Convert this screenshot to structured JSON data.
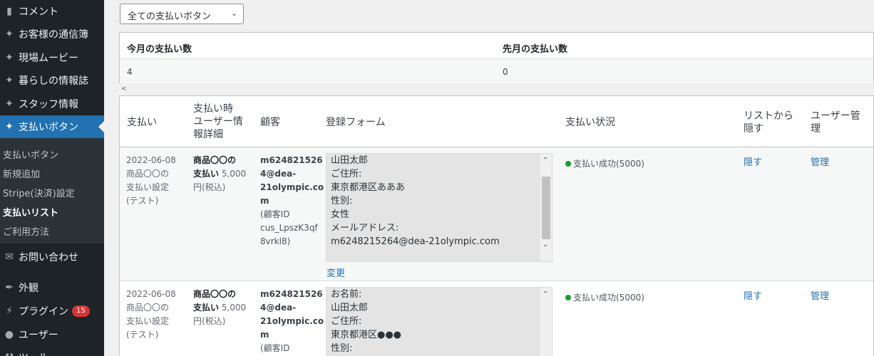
{
  "sidebar": {
    "menu": [
      {
        "label": "コメント",
        "icon": "comment-icon"
      },
      {
        "label": "お客様の通信簿",
        "icon": "pin-icon"
      },
      {
        "label": "現場ムービー",
        "icon": "pin-icon"
      },
      {
        "label": "暮らしの情報誌",
        "icon": "pin-icon"
      },
      {
        "label": "スタッフ情報",
        "icon": "pin-icon"
      },
      {
        "label": "支払いボタン",
        "icon": "pin-icon"
      }
    ],
    "submenu": [
      "支払いボタン",
      "新規追加",
      "Stripe(決済)設定",
      "支払いリスト",
      "ご利用方法"
    ],
    "menu2": [
      {
        "label": "お問い合わせ",
        "icon": "mail-icon"
      },
      {
        "label": "外観",
        "icon": "brush-icon"
      },
      {
        "label": "プラグイン",
        "icon": "plugin-icon",
        "badge": "15"
      },
      {
        "label": "ユーザー",
        "icon": "user-icon"
      },
      {
        "label": "ツール",
        "icon": "tool-icon"
      }
    ]
  },
  "filter": {
    "selected": "全ての支払いボタン"
  },
  "stats": {
    "this_month_label": "今月の支払い数",
    "last_month_label": "先月の支払い数",
    "this_month_value": "4",
    "last_month_value": "0"
  },
  "scroll_indicator": "<",
  "table": {
    "headers": {
      "payment": "支払い",
      "user_info": "支払い時\nユーザー情\n報詳細",
      "customer": "顧客",
      "form": "登録フォーム",
      "status": "支払い状況",
      "hide": "リストから\n隠す",
      "manage": "ユーザー管\n理"
    },
    "rows": [
      {
        "date": "2022-06-08",
        "button_name": "商品〇〇の\n支払い設定\n(テスト)",
        "product_bold": "商品〇〇の\n支払い",
        "price": " 5,000\n円(税込)",
        "customer_email": "m624821526\n4@dea-\n21olympic.co\nm",
        "customer_id": "(顧客ID\ncus_LpszK3qf\n8vrkl8)",
        "form_text": "山田太郎\nご住所:\n東京都港区あああ\n性別:\n女性\nメールアドレス:\nm6248215264@dea-21olympic.com",
        "change_link": "変更",
        "status_text": "支払い成功(5000)",
        "hide_link": "隠す",
        "manage_link": "管理"
      },
      {
        "date": "2022-06-08",
        "button_name": "商品〇〇の\n支払い設定\n(テスト)",
        "product_bold": "商品〇〇の\n支払い",
        "price": " 5,000\n円(税込)",
        "customer_email": "m624821526\n4@dea-\n21olympic.co\nm",
        "customer_id": "(顧客ID",
        "form_text": "お名前:\n山田太郎\nご住所:\n東京都港区●●●\n性別:",
        "status_text": "支払い成功(5000)",
        "hide_link": "隠す",
        "manage_link": "管理"
      }
    ]
  },
  "colors": {
    "sidebar_bg": "#1d2327",
    "active": "#2271b1",
    "success_dot": "#1a9c2b",
    "badge": "#d63638"
  }
}
